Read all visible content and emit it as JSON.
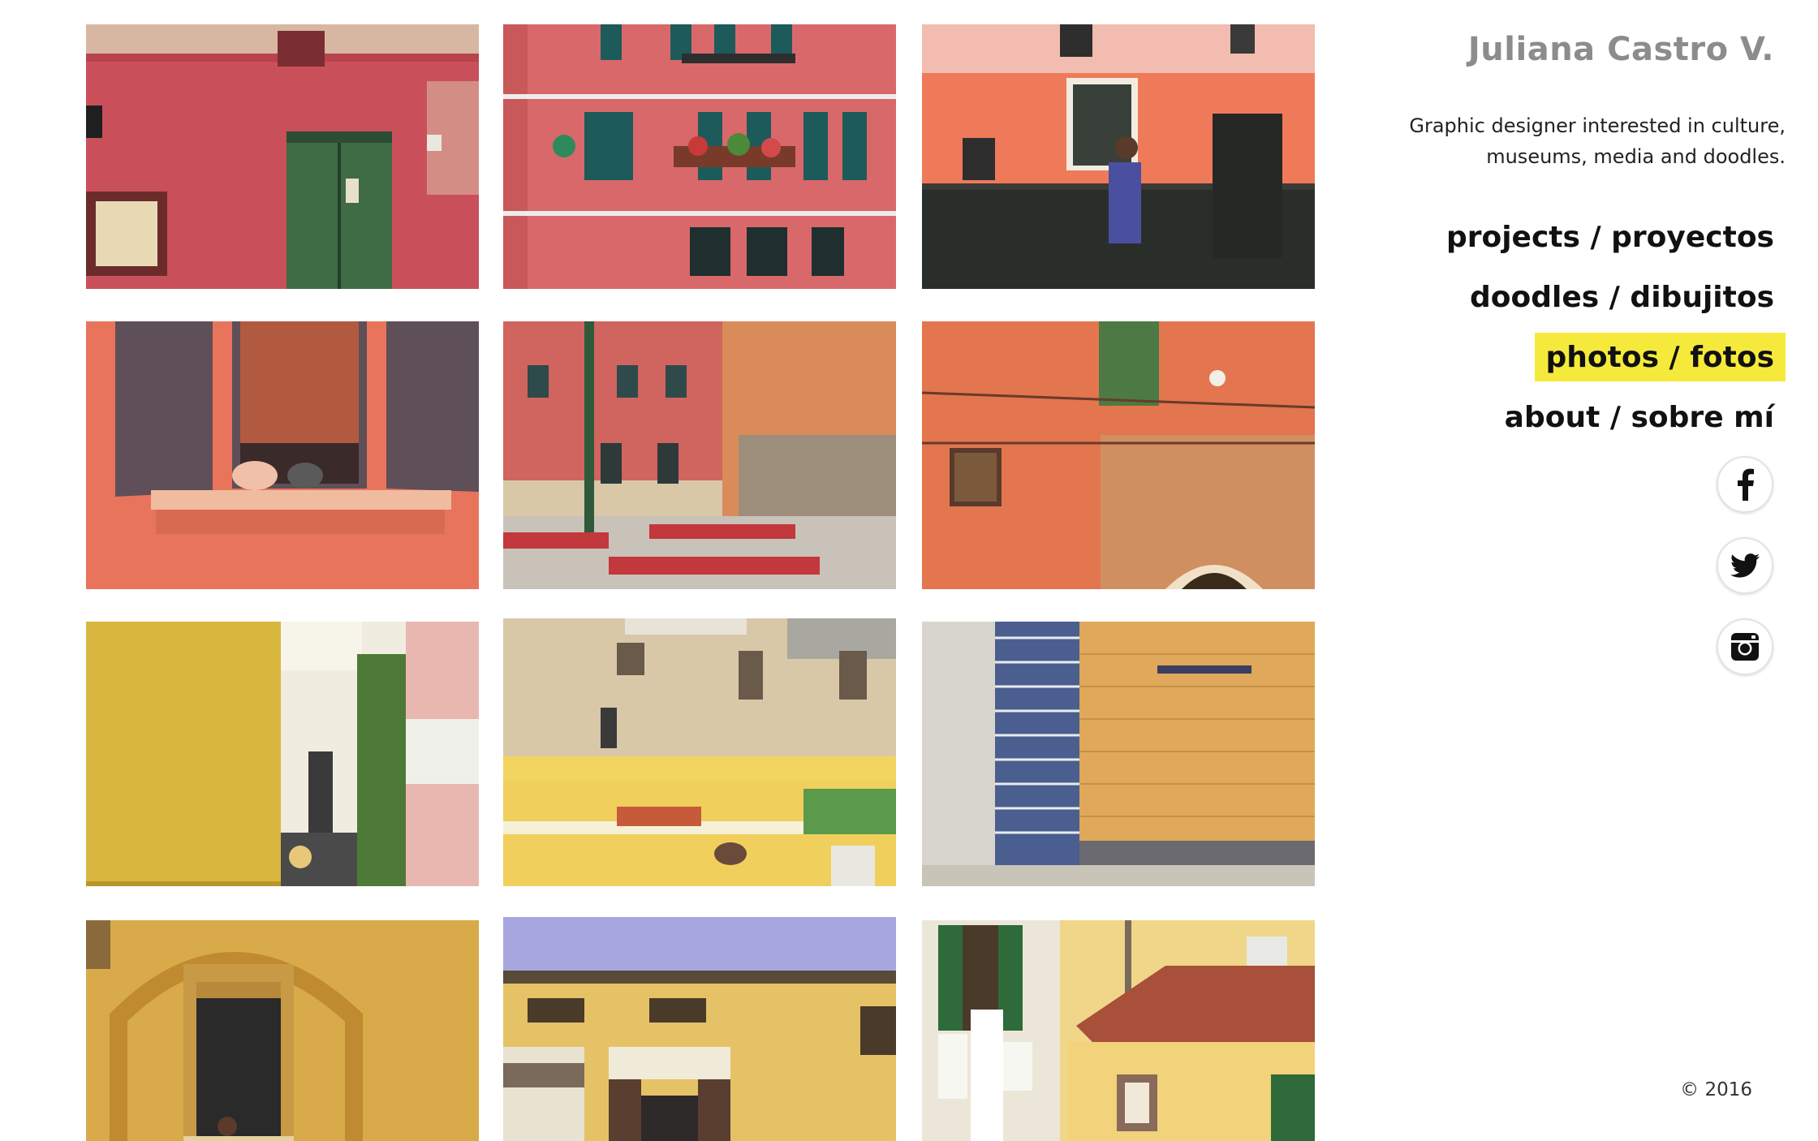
{
  "site": {
    "title": "Juliana Castro V.",
    "tagline_line1": "Graphic designer interested in culture,",
    "tagline_line2": "museums, media and doodles."
  },
  "nav": {
    "items": [
      {
        "label": "projects / proyectos",
        "active": false
      },
      {
        "label": "doodles / dibujitos",
        "active": false
      },
      {
        "label": "photos / fotos",
        "active": true
      },
      {
        "label": "about / sobre mí",
        "active": false
      }
    ],
    "highlight_color": "#f5ea3c"
  },
  "social": [
    {
      "name": "facebook-icon"
    },
    {
      "name": "twitter-icon"
    },
    {
      "name": "instagram-icon"
    }
  ],
  "footer": {
    "copyright": "© 2016"
  },
  "gallery": {
    "photos": [
      {
        "name": "photo-red-wall-green-door",
        "colors": [
          "#c9505a",
          "#3f6b45",
          "#e8d9b5"
        ]
      },
      {
        "name": "photo-pink-building-balconies",
        "colors": [
          "#d9686b",
          "#1d5b5a",
          "#ececec"
        ]
      },
      {
        "name": "photo-orange-wall-woman",
        "colors": [
          "#ee7a5a",
          "#2a2e2a",
          "#4a4fa0"
        ]
      },
      {
        "name": "photo-window-shutters-cat",
        "colors": [
          "#e8745c",
          "#5f4f58",
          "#b25a40"
        ]
      },
      {
        "name": "photo-square-red-benches",
        "colors": [
          "#d0645e",
          "#d98c5a",
          "#c2383d"
        ]
      },
      {
        "name": "photo-orange-wall-lamp",
        "colors": [
          "#e3754f",
          "#4d7a44",
          "#c89a6a"
        ]
      },
      {
        "name": "photo-yellow-alley",
        "colors": [
          "#d9b73e",
          "#f0ede0",
          "#4d7a36"
        ]
      },
      {
        "name": "photo-yellow-ledge-buildings",
        "colors": [
          "#f0cf5c",
          "#d8c8a8",
          "#c85a3c"
        ]
      },
      {
        "name": "photo-tiles-glass-facade",
        "colors": [
          "#e0a85a",
          "#4a5f8f",
          "#d8d5cd"
        ]
      },
      {
        "name": "photo-arch-window-man",
        "colors": [
          "#d8aa4a",
          "#2a2a2a",
          "#c99a45"
        ]
      },
      {
        "name": "photo-yellow-facade-sky",
        "colors": [
          "#e6c266",
          "#a7a6de",
          "#5a3e30"
        ]
      },
      {
        "name": "photo-laundry-tiled-roof",
        "colors": [
          "#f0d688",
          "#a8503a",
          "#2e6a3a"
        ]
      }
    ]
  }
}
